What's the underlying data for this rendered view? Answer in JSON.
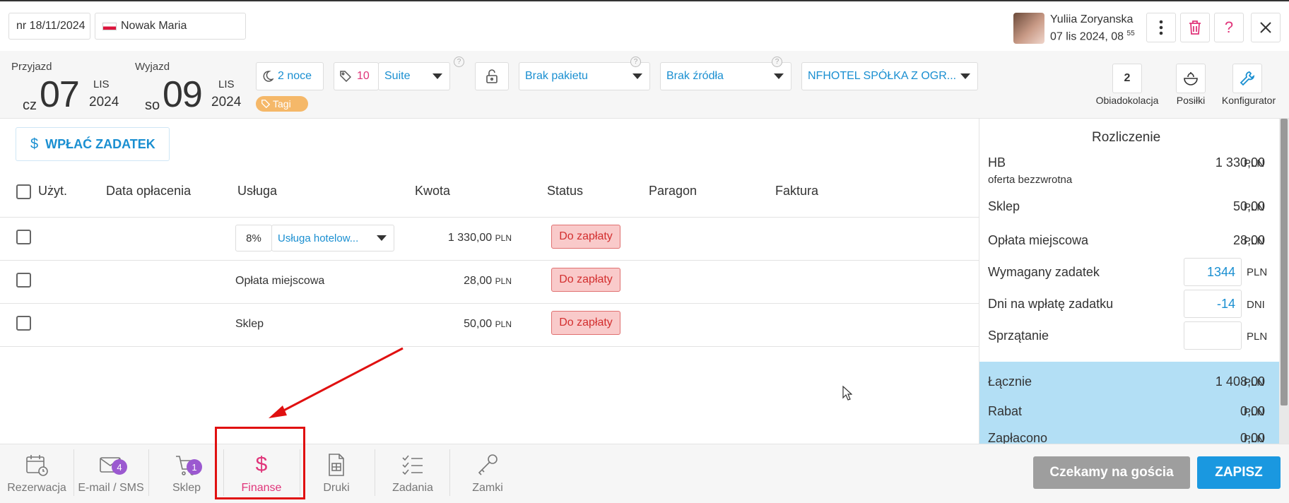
{
  "header": {
    "reservation_number": "nr 18/11/2024",
    "guest_name": "Nowak Maria",
    "user_name": "Yuliia Zoryanska",
    "user_date": "07 lis 2024, 08",
    "user_time_sup": "55"
  },
  "stay": {
    "arrival_label": "Przyjazd",
    "arrival_dow": "cz",
    "arrival_day": "07",
    "arrival_month": "LIS",
    "arrival_year": "2024",
    "departure_label": "Wyjazd",
    "departure_dow": "so",
    "departure_day": "09",
    "departure_month": "LIS",
    "departure_year": "2024",
    "nights": "2 noce",
    "room_number": "10",
    "room_type": "Suite",
    "package": "Brak pakietu",
    "source": "Brak źródła",
    "company": "NFHOTEL SPÓŁKA Z OGR...",
    "tags_label": "Tagi",
    "help_mark": "?"
  },
  "right_tools": {
    "obiadokolacja_count": "2",
    "obiadokolacja_label": "Obiadokolacja",
    "posilki_label": "Posiłki",
    "konfigurator_label": "Konfigurator"
  },
  "finance": {
    "deposit_button": "WPŁAĆ ZADATEK",
    "columns": {
      "used": "Użyt.",
      "paid_date": "Data opłacenia",
      "service": "Usługa",
      "amount": "Kwota",
      "status": "Status",
      "receipt": "Paragon",
      "invoice": "Faktura"
    },
    "rows": [
      {
        "vat": "8%",
        "service": "Usługa hotelow...",
        "amount": "1 330,00",
        "currency": "PLN",
        "status": "Do zapłaty"
      },
      {
        "service": "Opłata miejscowa",
        "amount": "28,00",
        "currency": "PLN",
        "status": "Do zapłaty"
      },
      {
        "service": "Sklep",
        "amount": "50,00",
        "currency": "PLN",
        "status": "Do zapłaty"
      }
    ]
  },
  "summary": {
    "title": "Rozliczenie",
    "hb_label": "HB",
    "hb_sub": "oferta bezzwrotna",
    "hb_value": "1 330,00",
    "shop_label": "Sklep",
    "shop_value": "50,00",
    "city_tax_label": "Opłata miejscowa",
    "city_tax_value": "28,00",
    "deposit_label": "Wymagany zadatek",
    "deposit_value": "1344",
    "deposit_days_label": "Dni na wpłatę zadatku",
    "deposit_days_value": "-14",
    "days_unit": "DNI",
    "cleaning_label": "Sprzątanie",
    "cleaning_value": "",
    "total_label": "Łącznie",
    "total_value": "1 408,00",
    "discount_label": "Rabat",
    "discount_value": "0,00",
    "paid_label": "Zapłacono",
    "paid_value": "0,00",
    "currency": "PLN"
  },
  "bottom_nav": {
    "tabs": [
      {
        "label": "Rezerwacja"
      },
      {
        "label": "E-mail / SMS",
        "badge": "4"
      },
      {
        "label": "Sklep",
        "badge": "1"
      },
      {
        "label": "Finanse"
      },
      {
        "label": "Druki"
      },
      {
        "label": "Zadania"
      },
      {
        "label": "Zamki"
      }
    ],
    "waiting_button": "Czekamy na gościa",
    "save_button": "ZAPISZ"
  },
  "colors": {
    "accent_blue": "#1a8fd1",
    "active_tab": "#e0357a",
    "status_bg": "#f9caca",
    "totals_bg": "#b3dff5",
    "highlight_red": "#e01010"
  }
}
